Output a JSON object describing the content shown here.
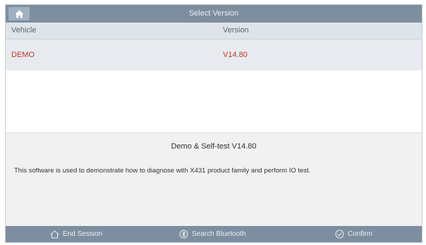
{
  "title": "Select Version",
  "columns": {
    "vehicle": "Vehicle",
    "version": "Version"
  },
  "rows": [
    {
      "vehicle": "DEMO",
      "version": "V14.80"
    }
  ],
  "description": {
    "title": "Demo & Self-test V14.80",
    "text": "This software is used to demonstrate how to diagnose with X431 product family and perform IO test."
  },
  "footer": {
    "end_session": "End Session",
    "search_bluetooth": "Search Bluetooth",
    "confirm": "Confirm"
  },
  "icons": [
    "home-icon",
    "end-session-icon",
    "search-bluetooth-icon",
    "confirm-check-icon"
  ],
  "colors": {
    "bar": "#7d8ea0",
    "accent_red": "#c0392b"
  }
}
